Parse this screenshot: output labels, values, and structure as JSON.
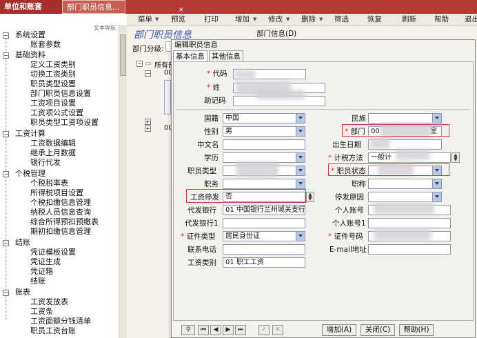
{
  "tabs": {
    "tab1": "单位和账套",
    "tab2": "部门职员信息..."
  },
  "toolbar": {
    "menu": "菜单",
    "preview": "预览",
    "print": "打印",
    "add": "增加",
    "edit": "修改",
    "delete": "删除",
    "filter": "筛选",
    "restore": "恢复",
    "refresh": "刷新",
    "help": "帮助",
    "exit": "退出"
  },
  "tree_header": "文本导航",
  "tree": {
    "sys": "系统设置",
    "sys_acct": "账套参数",
    "base": "基础资料",
    "b1": "定义工资类别",
    "b2": "切换工资类别",
    "b3": "职员类型设置",
    "b4": "部门职员信息设置",
    "b5": "工资项目设置",
    "b6": "工资项公式设置",
    "b7": "职员类型工资项设置",
    "calc": "工资计算",
    "c1": "工资数据编辑",
    "c2": "继承上月数据",
    "c3": "银行代发",
    "tax": "个税管理",
    "t1": "个税税率表",
    "t2": "所得税项目设置",
    "t3": "个税扣缴信息管理",
    "t4": "纳税人员信息查询",
    "t5": "综合所得预扣预缴表",
    "t6": "期初扣缴信息管理",
    "close": "结账",
    "k1": "凭证模板设置",
    "k2": "凭证生成",
    "k3": "凭证箱",
    "k4": "结账",
    "rep": "账表",
    "r1": "工资发放表",
    "r2": "工资条",
    "r3": "工资面额分钱清单",
    "r4": "职员工资台账"
  },
  "main": {
    "page_title": "部门职员信息",
    "group_label": "部门分级:",
    "info_label": "部门信息(D)",
    "tree_root": "所有部",
    "tree_item": "00"
  },
  "dialog": {
    "title": "编辑职员信息",
    "tab_basic": "基本信息",
    "tab_other": "其他信息",
    "labels": {
      "code": "代码",
      "name": "姓",
      "mnemonic": "助记码",
      "nationality": "国籍",
      "ethnicity": "民族",
      "gender": "性别",
      "dept": "部门",
      "cn_name": "中文名",
      "birth": "出生日期",
      "education": "学历",
      "tax_method": "计税方法",
      "emp_type": "职员类型",
      "emp_status": "职员状态",
      "position": "职务",
      "title": "职称",
      "pay_stop": "工资停发",
      "stop_reason": "停发原因",
      "bank": "代发银行",
      "personal_acct": "个人账号",
      "bank1": "代发银行1",
      "personal_acct1": "个人账号1",
      "id_type": "证件类型",
      "id_no": "证件号码",
      "phone": "联系电话",
      "email": "E-mail地址",
      "pay_category": "工资类别"
    },
    "values": {
      "code": "",
      "name": "",
      "mnemonic": "",
      "nationality": "中国",
      "ethnicity": "",
      "gender": "男",
      "dept": "00",
      "dept_tail": "室",
      "cn_name": "",
      "birth": "",
      "education": "",
      "tax_method": "一般计",
      "emp_type": "",
      "emp_status": "",
      "position": "",
      "title": "",
      "pay_stop": "否",
      "stop_reason": "",
      "bank": "01 中国银行兰州城关支行",
      "personal_acct": "",
      "bank1": "",
      "personal_acct1": "",
      "id_type": "居民身份证",
      "id_no": "",
      "phone": "",
      "email": "",
      "pay_category": "01 职工工资"
    },
    "buttons": {
      "add": "增加(A)",
      "close": "关闭(C)",
      "help": "帮助(H)"
    }
  },
  "colors": {
    "tab_red": "#b43a34",
    "title_blue": "#3a53b3",
    "highlight": "#d23c3c",
    "dropdown": "#b7c9e6"
  }
}
